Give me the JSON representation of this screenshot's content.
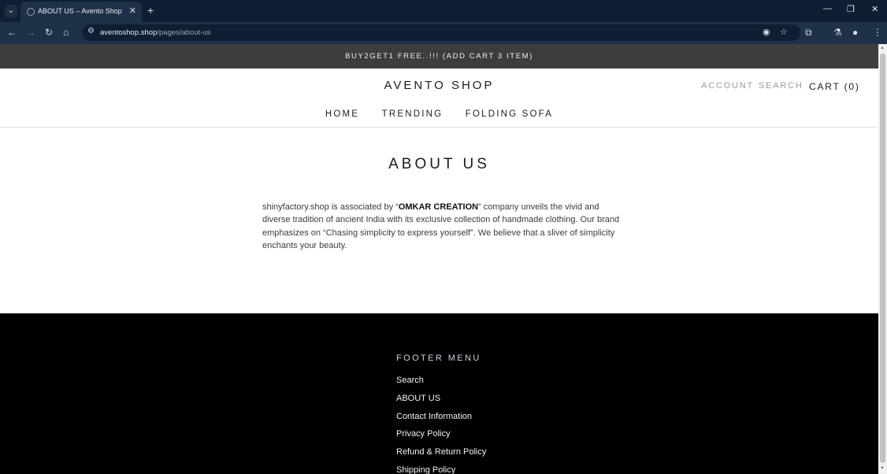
{
  "browser": {
    "tab_title": "ABOUT US – Avento Shop",
    "url_domain": "aventoshop.shop",
    "url_path": "/pages/about-us"
  },
  "announcement": "BUY2GET1 FREE..!!! (ADD CART 3 ITEM)",
  "header": {
    "logo": "AVENTO SHOP",
    "account": "ACCOUNT",
    "search": "SEARCH",
    "cart": "CART (0)"
  },
  "nav": [
    "HOME",
    "TRENDING",
    "FOLDING SOFA"
  ],
  "page": {
    "title": "ABOUT US",
    "text_before": "shinyfactory.shop is associated by “",
    "text_bold": "OMKAR CREATION",
    "text_after": "” company unveils the vivid and diverse tradition of ancient India with its exclusive collection of handmade clothing. Our brand emphasizes on “Chasing simplicity to express yourself”. We believe that a sliver of simplicity enchants your beauty."
  },
  "footer": {
    "heading": "FOOTER MENU",
    "links": [
      "Search",
      "ABOUT US",
      "Contact Information",
      "Privacy Policy",
      "Refund & Return Policy",
      "Shipping Policy"
    ]
  },
  "colors": {
    "chrome_dark": "#0f1f33",
    "chrome_toolbar": "#1e3149",
    "announcement_bg": "#3d3d3d",
    "footer_bg": "#000000"
  }
}
